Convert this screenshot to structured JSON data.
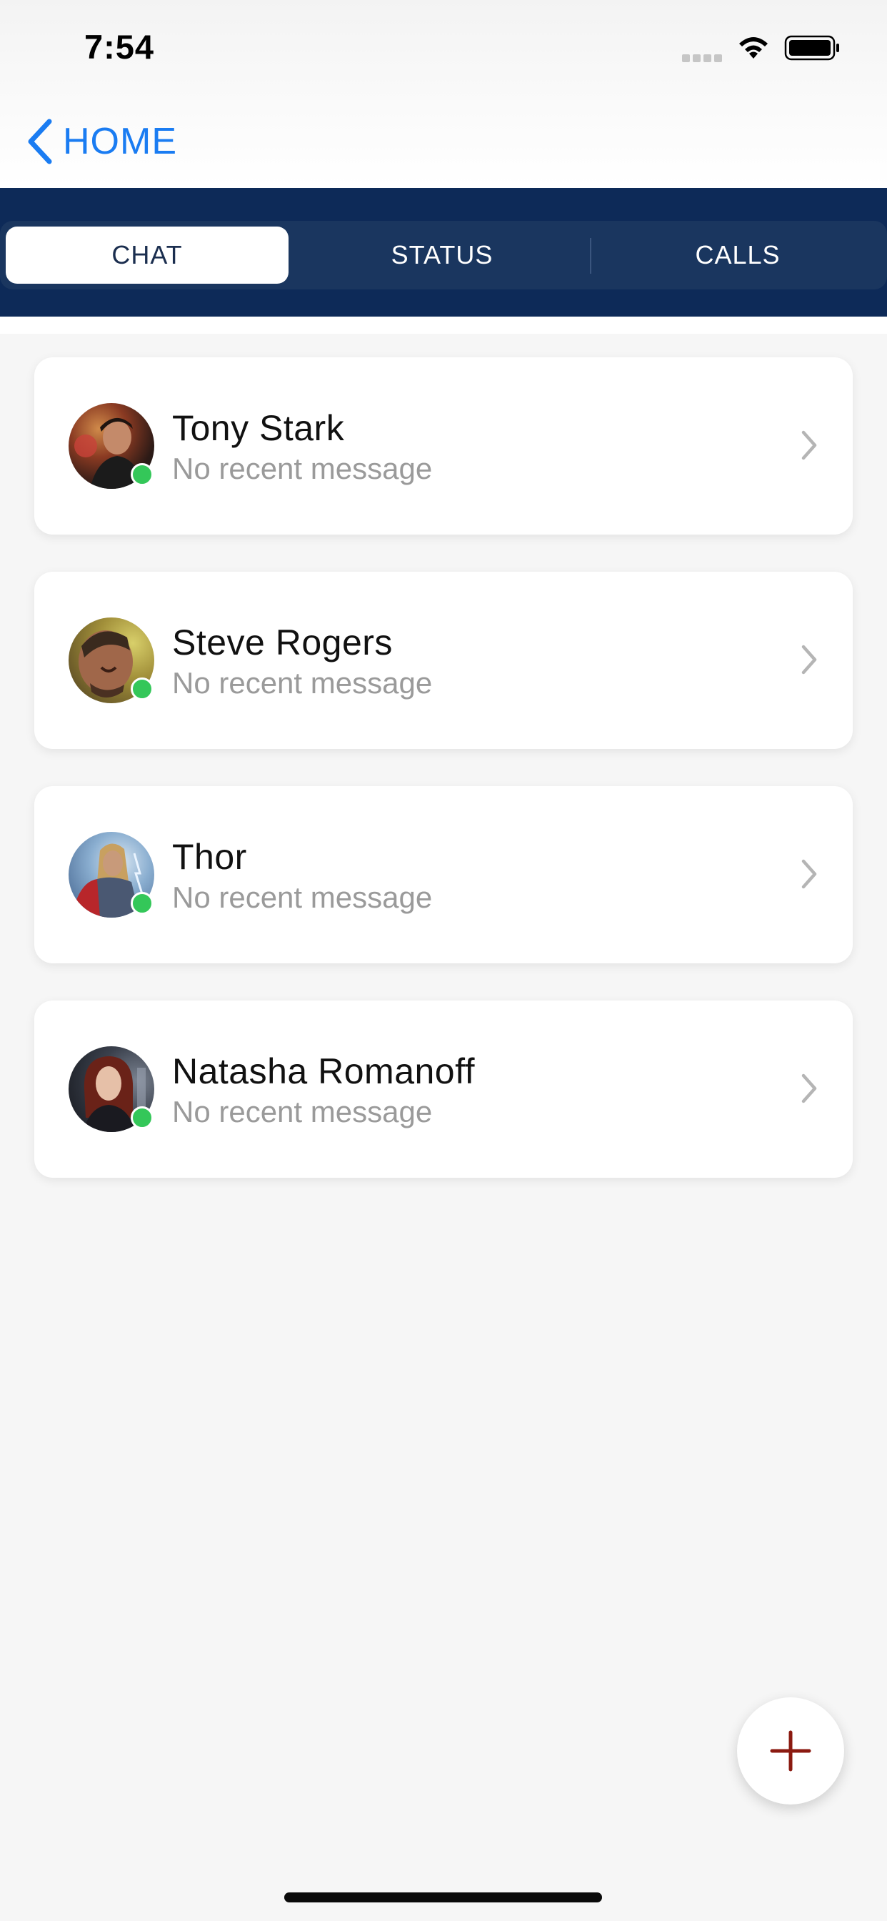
{
  "status_bar": {
    "time": "7:54",
    "icons": [
      "cellular-signal-icon",
      "wifi-icon",
      "battery-icon"
    ]
  },
  "nav": {
    "back_label": "HOME",
    "back_icon": "chevron-left-icon",
    "accent_color": "#1a7cf2"
  },
  "tabs": {
    "items": [
      {
        "label": "CHAT",
        "active": true
      },
      {
        "label": "STATUS",
        "active": false
      },
      {
        "label": "CALLS",
        "active": false
      }
    ],
    "band_color": "#0d2a58"
  },
  "chats": [
    {
      "name": "Tony Stark",
      "preview": "No recent message",
      "online": true
    },
    {
      "name": "Steve Rogers",
      "preview": "No recent message",
      "online": true
    },
    {
      "name": "Thor",
      "preview": "No recent message",
      "online": true
    },
    {
      "name": "Natasha Romanoff",
      "preview": "No recent message",
      "online": true
    }
  ],
  "fab": {
    "icon": "plus-icon",
    "color": "#8b1a10"
  },
  "colors": {
    "online": "#34c759",
    "background": "#f6f6f6"
  }
}
